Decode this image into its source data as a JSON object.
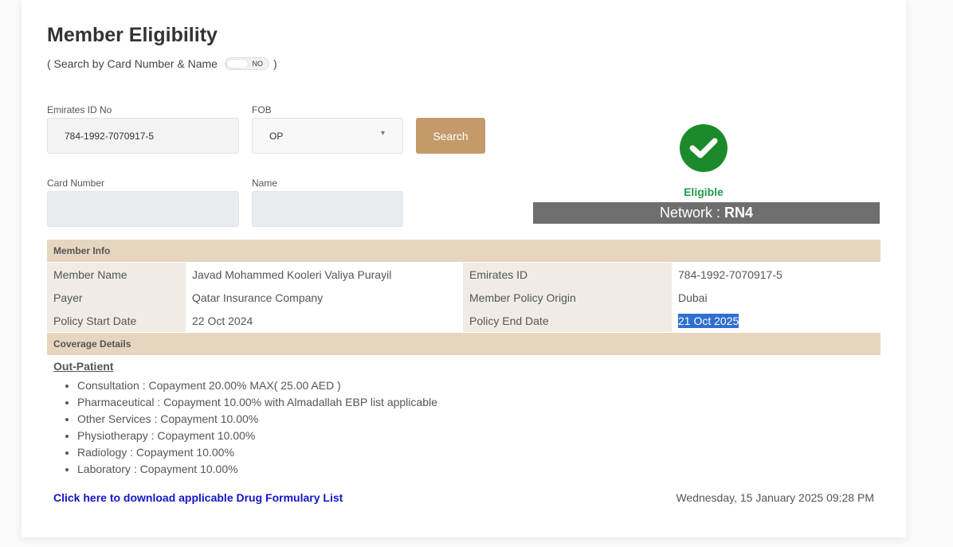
{
  "page": {
    "title": "Member Eligibility",
    "search_toggle": {
      "prefix": "( Search by Card Number & Name",
      "state_label": "NO",
      "suffix": ")"
    }
  },
  "form": {
    "emirates_id": {
      "label": "Emirates ID No",
      "value": "784-1992-7070917-5"
    },
    "fob": {
      "label": "FOB",
      "selected": "OP"
    },
    "search_button": "Search",
    "card_number": {
      "label": "Card Number",
      "value": ""
    },
    "name": {
      "label": "Name",
      "value": ""
    }
  },
  "status": {
    "icon": "check-circle-icon",
    "label": "Eligible",
    "network_prefix": "Network :",
    "network_value": "RN4",
    "color": "#1b8a2a"
  },
  "member_info": {
    "heading": "Member Info",
    "rows": [
      {
        "k1": "Member Name",
        "v1": "Javad Mohammed Kooleri Valiya Purayil",
        "k2": "Emirates ID",
        "v2": "784-1992-7070917-5"
      },
      {
        "k1": "Payer",
        "v1": "Qatar Insurance Company",
        "k2": "Member Policy Origin",
        "v2": "Dubai"
      },
      {
        "k1": "Policy Start Date",
        "v1": "22 Oct 2024",
        "k2": "Policy End Date",
        "v2": "21 Oct 2025"
      }
    ]
  },
  "coverage": {
    "heading": "Coverage Details",
    "section_title": "Out-Patient",
    "items": [
      "Consultation : Copayment 20.00% MAX( 25.00 AED )",
      "Pharmaceutical : Copayment 10.00% with Almadallah EBP list applicable",
      "Other Services : Copayment 10.00%",
      "Physiotherapy : Copayment 10.00%",
      "Radiology : Copayment 10.00%",
      "Laboratory : Copayment 10.00%"
    ]
  },
  "footer": {
    "download_link": "Click here to download applicable Drug Formulary List",
    "datetime": "Wednesday, 15 January 2025 09:28 PM"
  },
  "colors": {
    "accent_button": "#c49a6a",
    "section_header": "#e6d6bf",
    "network_bar": "#6e6e6e",
    "eligible_text": "#1f9a4c",
    "link": "#1515c8"
  }
}
